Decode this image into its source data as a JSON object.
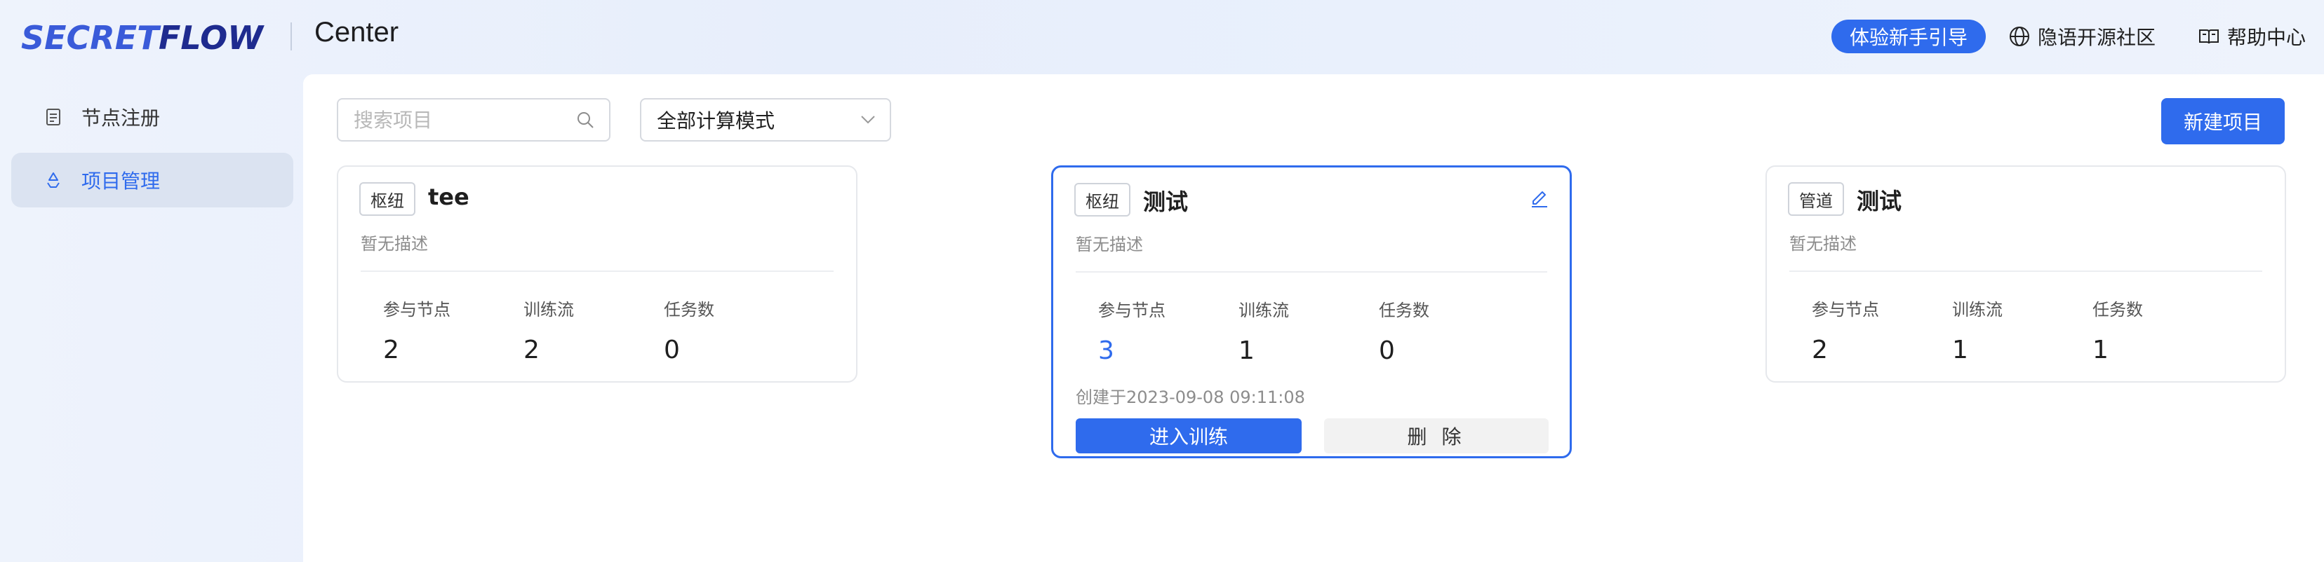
{
  "header": {
    "logo_text": "SECRETFLOW",
    "app_name": "Center",
    "guide_button": "体验新手引导",
    "community_link": "隐语开源社区",
    "help_link": "帮助中心"
  },
  "sidebar": {
    "items": [
      {
        "label": "节点注册",
        "icon": "document-icon",
        "active": false
      },
      {
        "label": "项目管理",
        "icon": "recycle-icon",
        "active": true
      }
    ]
  },
  "toolbar": {
    "search_placeholder": "搜索项目",
    "mode_select": "全部计算模式",
    "new_project_button": "新建项目"
  },
  "cards": [
    {
      "tag": "枢纽",
      "title": "tee",
      "desc": "暂无描述",
      "stats": [
        {
          "label": "参与节点",
          "value": "2"
        },
        {
          "label": "训练流",
          "value": "2"
        },
        {
          "label": "任务数",
          "value": "0"
        }
      ]
    },
    {
      "tag": "枢纽",
      "title": "测试",
      "desc": "暂无描述",
      "stats": [
        {
          "label": "参与节点",
          "value": "3"
        },
        {
          "label": "训练流",
          "value": "1"
        },
        {
          "label": "任务数",
          "value": "0"
        }
      ],
      "created": "创建于2023-09-08 09:11:08",
      "enter_button": "进入训练",
      "delete_button": "删 除"
    },
    {
      "tag": "管道",
      "title": "测试",
      "desc": "暂无描述",
      "stats": [
        {
          "label": "参与节点",
          "value": "2"
        },
        {
          "label": "训练流",
          "value": "1"
        },
        {
          "label": "任务数",
          "value": "1"
        }
      ]
    }
  ],
  "colors": {
    "accent": "#2f6bed",
    "annotation_arrow": "#e0392d"
  }
}
